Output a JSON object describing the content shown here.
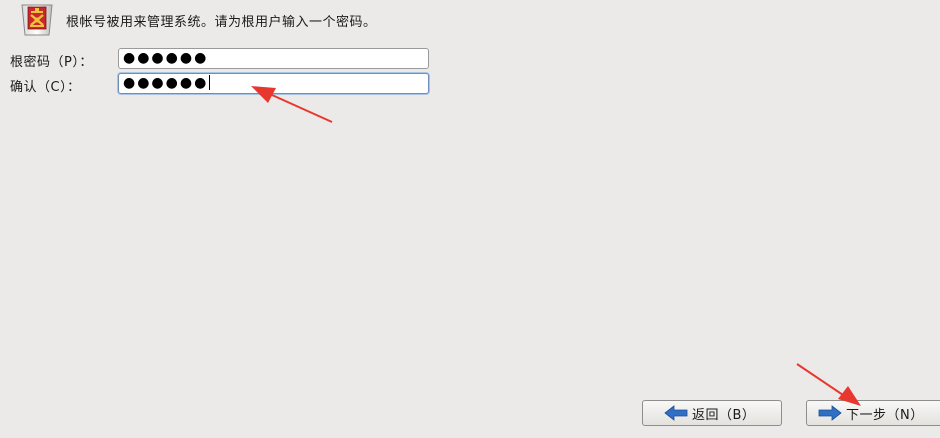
{
  "header": {
    "instruction": "根帐号被用来管理系统。请为根用户输入一个密码。"
  },
  "form": {
    "password_label": "根密码（P）：",
    "password_value": "●●●●●●",
    "confirm_label": "确认（C）：",
    "confirm_value": "●●●●●●"
  },
  "buttons": {
    "back_label": "返回（B）",
    "next_label": "下一步（N）"
  },
  "colors": {
    "background": "#ebeae8",
    "arrow_annotation": "#e8372f",
    "button_arrow_icon": "#2f6fc4"
  }
}
